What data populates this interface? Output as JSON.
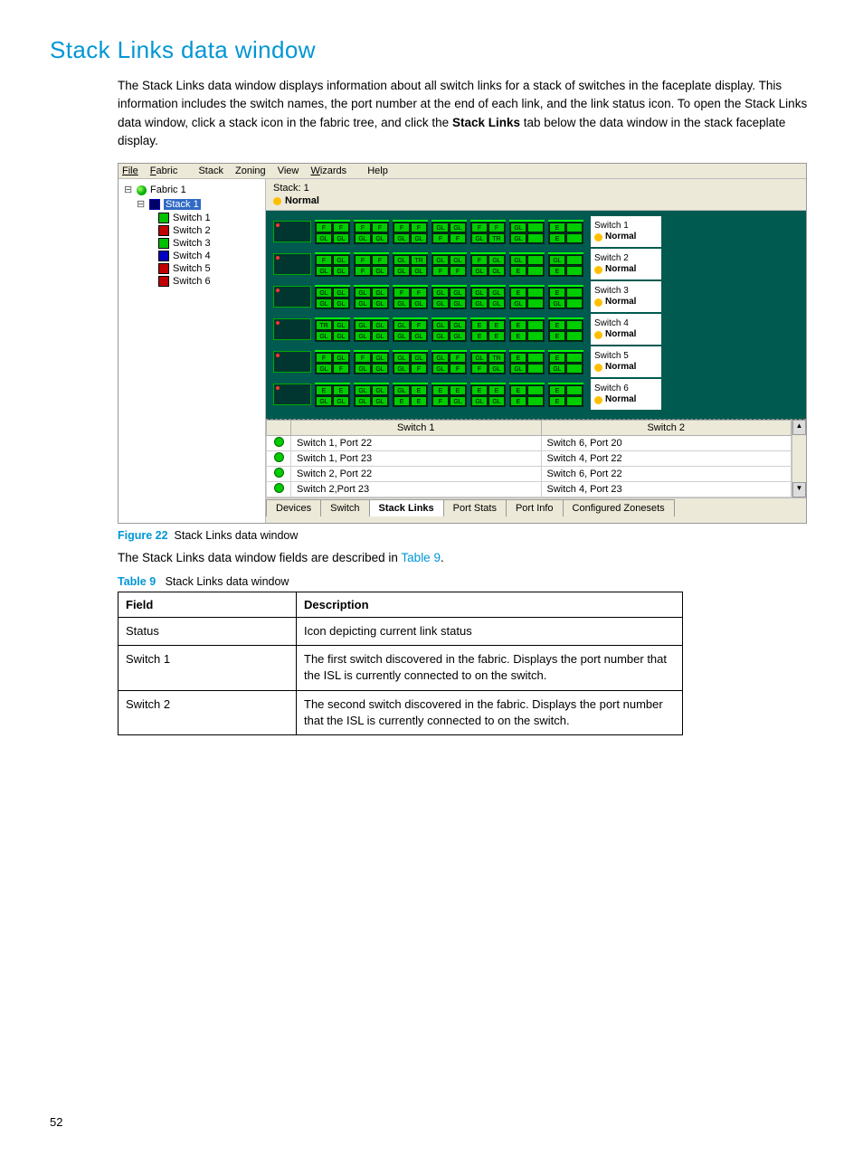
{
  "title": "Stack Links data window",
  "intro_before_bold": "The Stack Links data window displays information about all switch links for a stack of switches in the faceplate display. This information includes the switch names, the port number at the end of each link, and the link status icon. To open the Stack Links data window, click a stack icon in the fabric tree, and click the ",
  "intro_bold": "Stack Links",
  "intro_after_bold": " tab below the data window in the stack faceplate display.",
  "menubar": [
    "File",
    "Fabric",
    "Stack",
    "Zoning",
    "View",
    "Wizards",
    "Help"
  ],
  "tree": {
    "fabric": "Fabric 1",
    "stack": "Stack 1",
    "switches": [
      {
        "label": "Switch 1",
        "color": "#00c000"
      },
      {
        "label": "Switch 2",
        "color": "#c00000"
      },
      {
        "label": "Switch 3",
        "color": "#00c000"
      },
      {
        "label": "Switch 4",
        "color": "#0000c0"
      },
      {
        "label": "Switch 5",
        "color": "#c00000"
      },
      {
        "label": "Switch 6",
        "color": "#c00000"
      }
    ]
  },
  "header": {
    "name": "Stack: 1",
    "status": "Normal"
  },
  "chassis_rows": [
    {
      "label": "Switch 1",
      "status": "Normal"
    },
    {
      "label": "Switch 2",
      "status": "Normal"
    },
    {
      "label": "Switch 3",
      "status": "Normal"
    },
    {
      "label": "Switch 4",
      "status": "Normal"
    },
    {
      "label": "Switch 5",
      "status": "Normal"
    },
    {
      "label": "Switch 6",
      "status": "Normal"
    }
  ],
  "port_labels": [
    "F",
    "GL",
    "TR",
    "E"
  ],
  "links_table": {
    "headers": [
      "Switch 1",
      "Switch 2"
    ],
    "rows": [
      {
        "s1": "Switch 1, Port 22",
        "s2": "Switch 6, Port 20"
      },
      {
        "s1": "Switch 1, Port 23",
        "s2": "Switch 4, Port 22"
      },
      {
        "s1": "Switch 2, Port 22",
        "s2": "Switch 6, Port 22"
      },
      {
        "s1": "Switch 2,Port 23",
        "s2": "Switch 4, Port 23"
      }
    ]
  },
  "tabs": [
    "Devices",
    "Switch",
    "Stack Links",
    "Port Stats",
    "Port Info",
    "Configured Zonesets"
  ],
  "active_tab": "Stack Links",
  "figure": {
    "label": "Figure 22",
    "text": "Stack Links data window"
  },
  "desc_before_link": "The Stack Links data window fields are described in ",
  "desc_link": "Table 9",
  "desc_after_link": ".",
  "table_caption": {
    "label": "Table 9",
    "text": "Stack Links data window"
  },
  "fields_table": {
    "headers": [
      "Field",
      "Description"
    ],
    "rows": [
      {
        "field": "Status",
        "desc": "Icon depicting current link status"
      },
      {
        "field": "Switch 1",
        "desc": "The first switch discovered in the fabric. Displays the port number that the ISL is currently connected to on the switch."
      },
      {
        "field": "Switch 2",
        "desc": "The second switch discovered in the fabric. Displays the port number that the ISL is currently connected to on the switch."
      }
    ]
  },
  "page_number": "52"
}
